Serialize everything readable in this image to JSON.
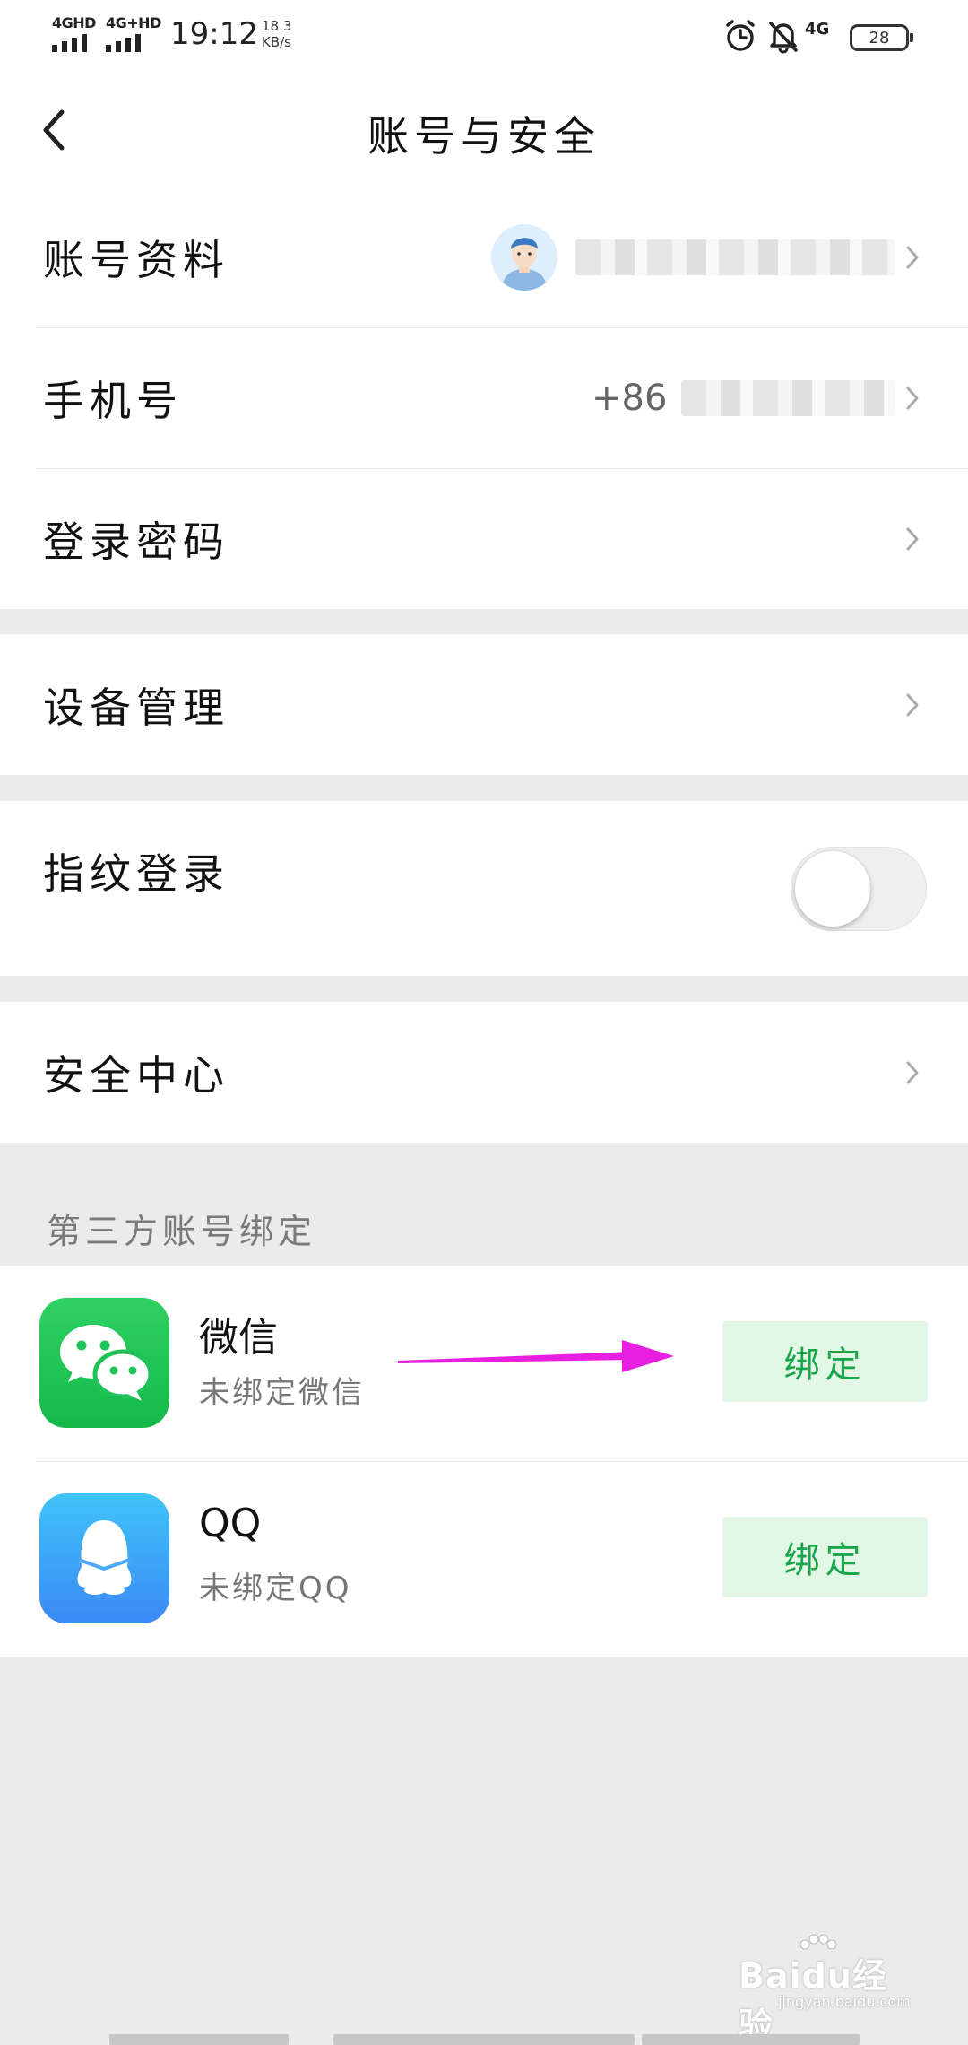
{
  "status_bar": {
    "sim1": "4GHD",
    "sim2": "4G+HD",
    "time": "19:12",
    "speed_value": "18.3",
    "speed_unit": "KB/s",
    "network": "4G",
    "battery": "28",
    "icons": [
      "alarm-icon",
      "bell-off-icon"
    ]
  },
  "nav": {
    "title": "账号与安全",
    "back_icon": "chevron-left-icon"
  },
  "account": {
    "profile_label": "账号资料",
    "phone_label": "手机号",
    "phone_prefix": "+86",
    "password_label": "登录密码"
  },
  "device": {
    "label": "设备管理"
  },
  "fingerprint": {
    "label": "指纹登录",
    "enabled": false
  },
  "security": {
    "label": "安全中心"
  },
  "third_party": {
    "header": "第三方账号绑定",
    "items": [
      {
        "name": "微信",
        "status": "未绑定微信",
        "button": "绑定",
        "icon": "wechat-icon"
      },
      {
        "name": "QQ",
        "status": "未绑定QQ",
        "button": "绑定",
        "icon": "qq-icon"
      }
    ]
  },
  "annotation": {
    "arrow_color": "#e81fe0"
  },
  "watermark": {
    "brand": "Baidu经验",
    "url": "jingyan.baidu.com"
  },
  "colors": {
    "accent_green": "#1aa64a",
    "bind_bg": "#e2f7e6",
    "page_bg": "#ebebeb"
  }
}
